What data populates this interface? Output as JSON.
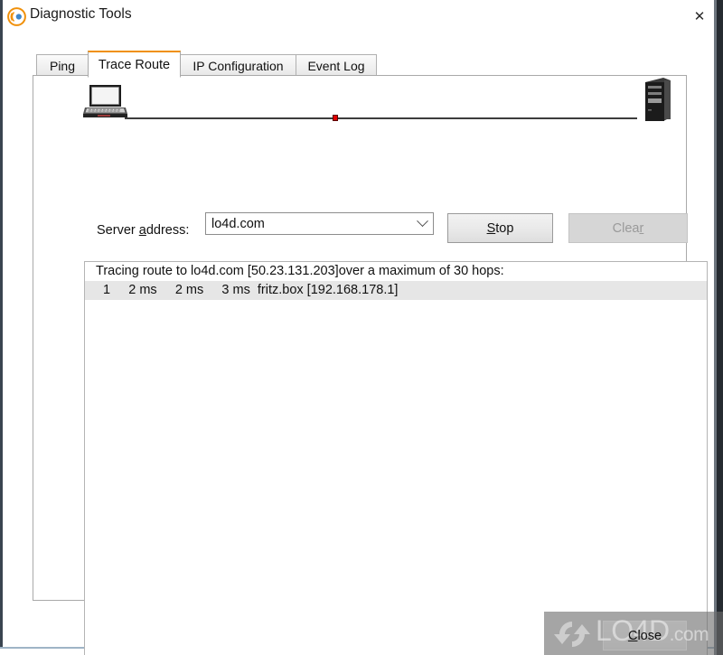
{
  "window": {
    "title": "Diagnostic Tools",
    "icon": "radar-globe-icon",
    "close_icon": "✕",
    "accent_color": "#f0900a"
  },
  "tabs": [
    {
      "label": "Ping",
      "active": false
    },
    {
      "label": "Trace Route",
      "active": true
    },
    {
      "label": "IP Configuration",
      "active": false
    },
    {
      "label": "Event Log",
      "active": false
    }
  ],
  "diagram": {
    "source_icon": "laptop-icon",
    "target_icon": "server-tower-icon",
    "marker_color": "#e00000"
  },
  "form": {
    "address_label_pre": "Server ",
    "address_label_accel": "a",
    "address_label_post": "ddress:",
    "address_value": "lo4d.com",
    "address_placeholder": "",
    "dropdown_icon": "chevron-down-icon"
  },
  "buttons": {
    "stop_accel": "S",
    "stop_rest": "top",
    "clear_pre": "Clea",
    "clear_accel": "r",
    "clear_rest": "",
    "clear_disabled": true,
    "close_accel": "C",
    "close_rest": "lose"
  },
  "output": {
    "lines": [
      {
        "text": "Tracing route to lo4d.com [50.23.131.203]over a maximum of 30 hops:",
        "selected": false
      },
      {
        "text": "  1     2 ms     2 ms     3 ms  fritz.box [192.168.178.1]",
        "selected": true
      }
    ]
  },
  "watermark": {
    "brand": "LO4D",
    "suffix": ".com",
    "logo": "refresh-arrows-icon"
  }
}
